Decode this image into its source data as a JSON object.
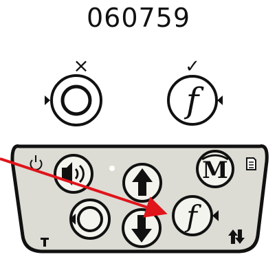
{
  "header": {
    "code": "060759"
  },
  "status_marks": {
    "left": "×",
    "right": "✓"
  },
  "icons": {
    "cancel_mark": "x-mark-icon",
    "confirm_mark": "check-mark-icon",
    "rotate": "circular-arrows-icon",
    "function": "function-f-icon",
    "power": "power-icon",
    "sound": "speaker-icon",
    "up": "arrow-up-icon",
    "down": "arrow-down-icon",
    "mode": "m-symbol-icon",
    "menu": "document-icon",
    "tilt": "tilt-icon",
    "updown": "up-down-arrows-icon"
  },
  "labels": {
    "function_glyph": "f"
  },
  "colors": {
    "panel_fill": "#dcdcd4",
    "outline": "#111111",
    "pointer": "#e0141b",
    "button_fill": "#f4f4ef"
  }
}
